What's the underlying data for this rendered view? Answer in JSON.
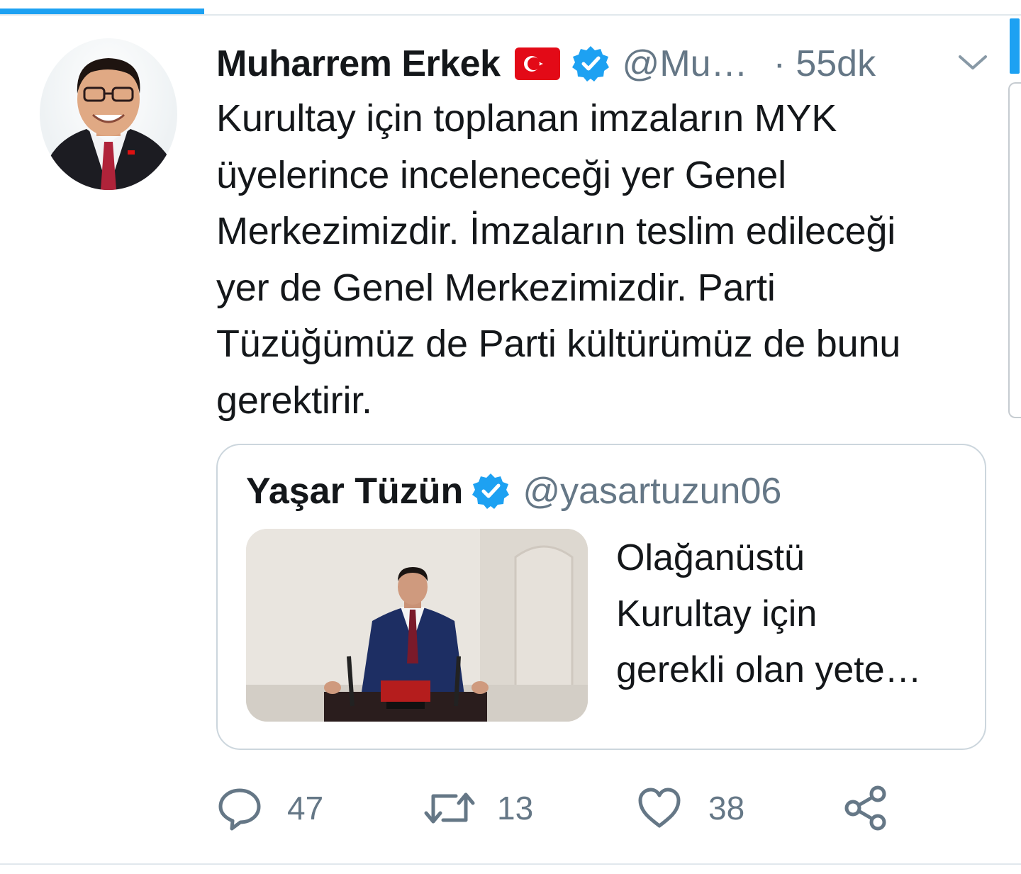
{
  "tweet": {
    "author_name": "Muharrem Erkek",
    "flag_icon": "turkey-flag-icon",
    "handle": "@Mu…",
    "time": "· 55dk",
    "text_lines": [
      "Kurultay için toplanan imzaların MYK",
      "üyelerince inceleneceği yer Genel",
      "Merkezimizdir. İmzaların teslim edileceği",
      "yer de Genel Merkezimizdir. Parti",
      "Tüzüğümüz de Parti kültürümüz de bunu",
      "gerektirir."
    ]
  },
  "quote": {
    "author_name": "Yaşar Tüzün",
    "handle": "@yasartuzun06",
    "text_lines": [
      "Olağanüstü",
      "Kurultay için",
      "gerekli olan yete…"
    ]
  },
  "actions": {
    "replies": "47",
    "retweets": "13",
    "likes": "38"
  },
  "colors": {
    "accent": "#1da1f2",
    "secondary_text": "#657786",
    "border": "#ccd6dd",
    "flag_red": "#e30a17"
  }
}
